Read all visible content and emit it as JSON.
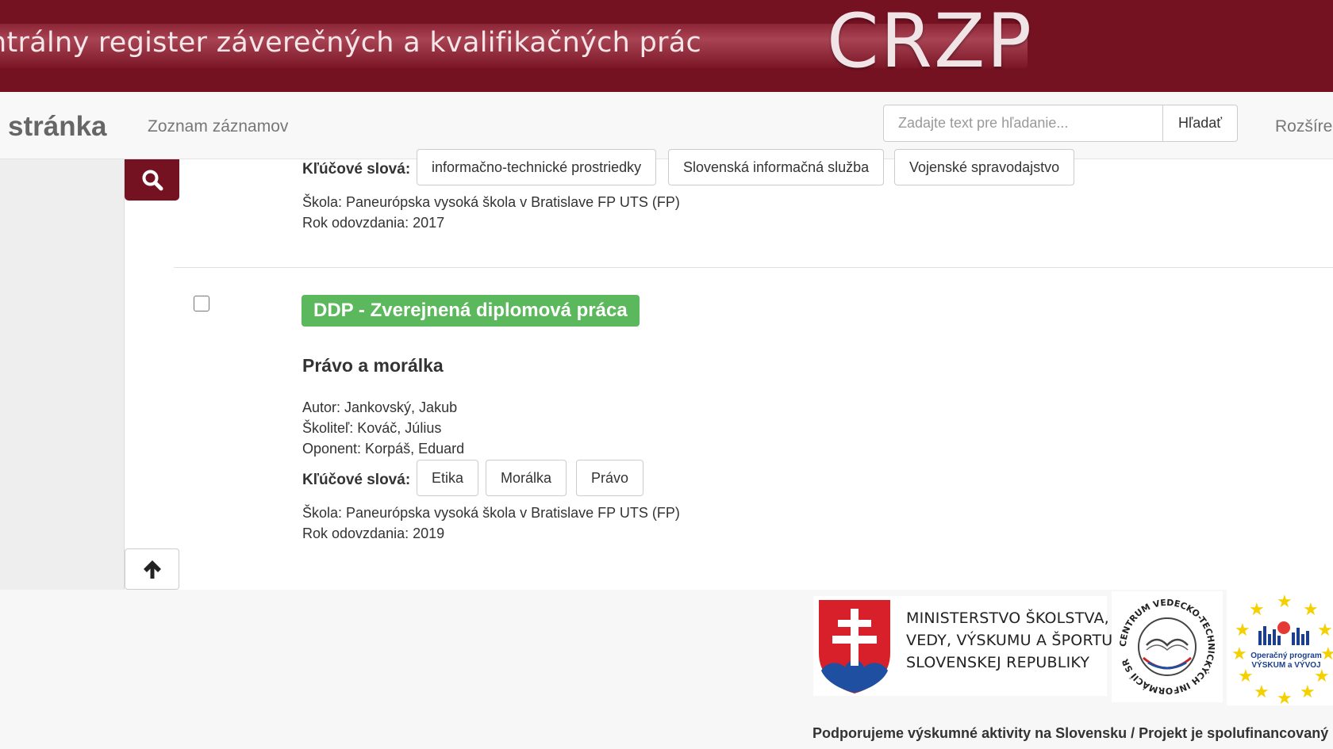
{
  "banner": {
    "title": "ntrálny register záverečných a kvalifikačných prác",
    "logo": "CRZP"
  },
  "navbar": {
    "brand": "stránka",
    "list_link": "Zoznam záznamov",
    "search_placeholder": "Zadajte text pre hľadanie...",
    "search_button": "Hľadať",
    "advanced_link": "Rozšíre"
  },
  "sidebar": {
    "search_icon": "search-icon",
    "scroll_top_icon": "arrow-up-icon"
  },
  "records": [
    {
      "keywords_label": "Kľúčové slová:",
      "keywords": [
        "informačno-technické prostriedky",
        "Slovenská informačná služba",
        "Vojenské spravodajstvo"
      ],
      "school": "Škola: Paneurópska vysoká škola v Bratislave FP UTS (FP)",
      "year": "Rok odovzdania: 2017"
    },
    {
      "type": "DDP - Zverejnená diplomová práca",
      "title": "Právo a morálka",
      "author": "Autor: Jankovský, Jakub",
      "supervisor": "Školiteľ: Kováč, Július",
      "opponent": "Oponent: Korpáš, Eduard",
      "keywords_label": "Kľúčové slová:",
      "keywords": [
        "Etika",
        "Morálka",
        "Právo"
      ],
      "school": "Škola: Paneurópska vysoká škola v Bratislave FP UTS (FP)",
      "year": "Rok odovzdania: 2019"
    }
  ],
  "footer": {
    "ministry_lines": [
      "MINISTERSTVO ŠKOLSTVA,",
      "VEDY, VÝSKUMU A ŠPORTU",
      "SLOVENSKEJ REPUBLIKY"
    ],
    "cvti_ring_text": "CENTRUM VEDECKO-TECHNICKÝCH INFORMÁCIÍ SR",
    "op_text": [
      "Operačný program",
      "VÝSKUM a VÝVOJ"
    ],
    "note": "Podporujeme výskumné aktivity na Slovensku / Projekt je spolufinancovaný"
  },
  "colors": {
    "brand": "#751222",
    "badge": "#5cb85c"
  }
}
